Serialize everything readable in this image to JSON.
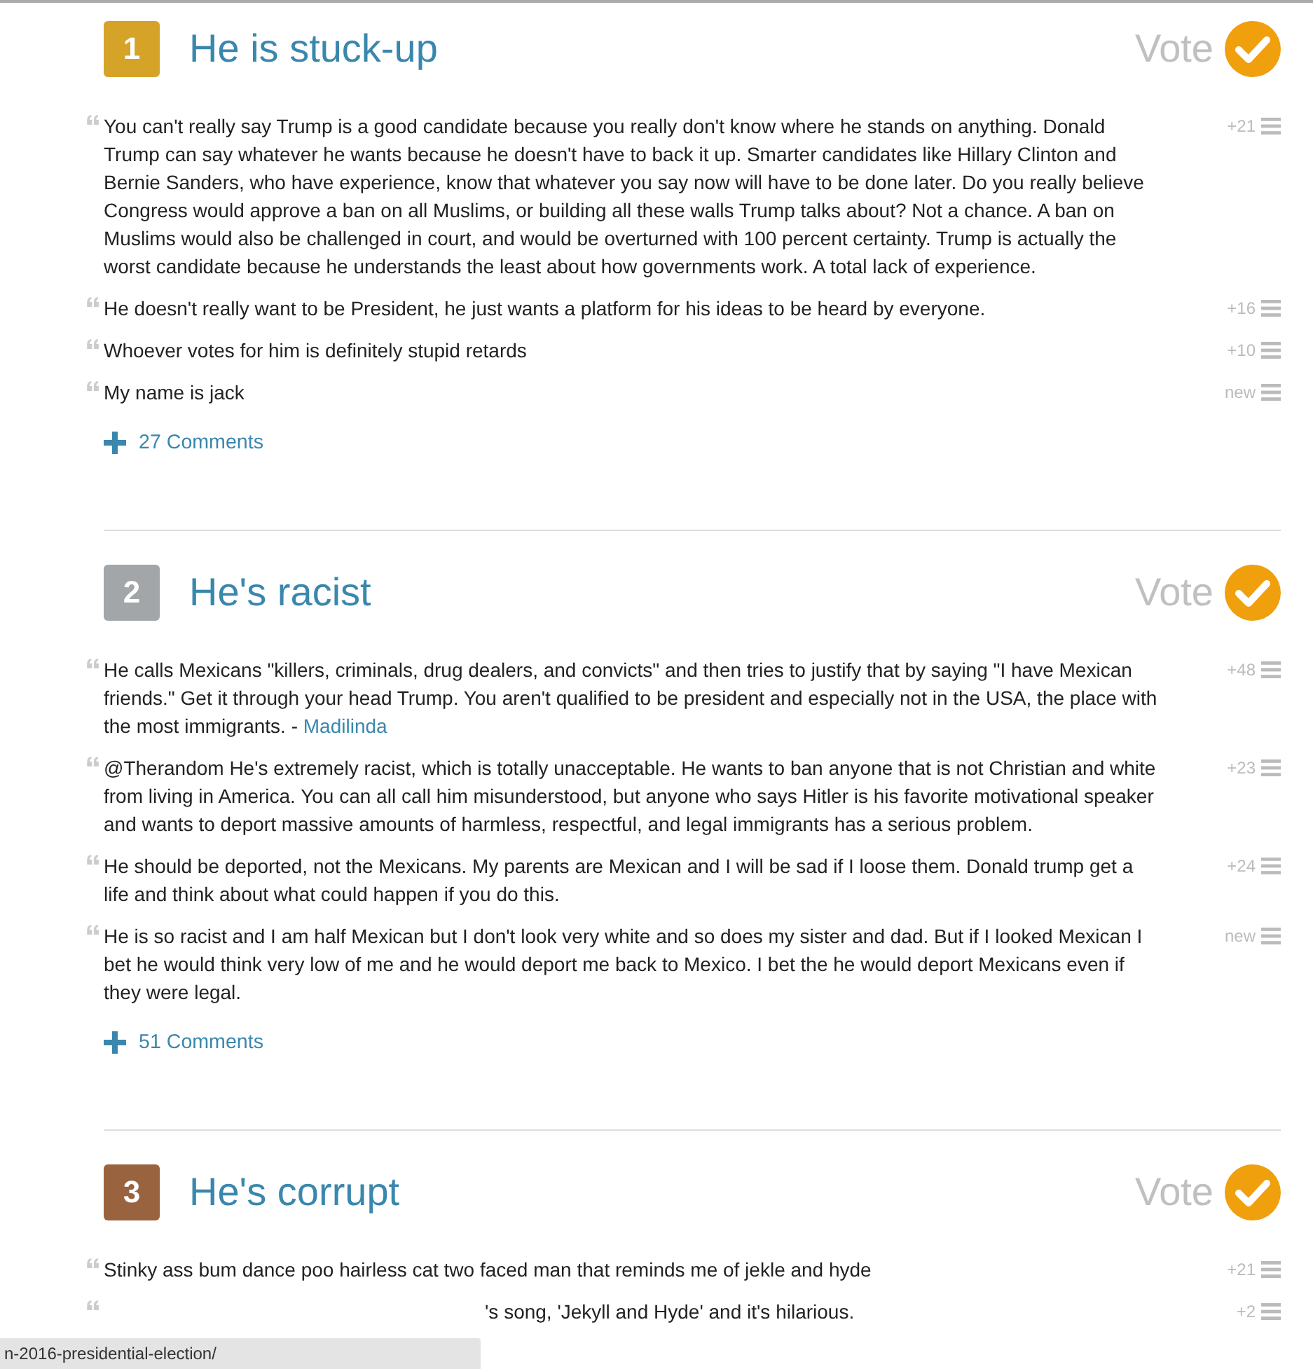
{
  "sections": [
    {
      "rank": "1",
      "color": "#d6a329",
      "title": "He is stuck-up",
      "vote": "Vote",
      "comments": [
        {
          "kind": "full",
          "text": "You can't really say Trump is a good candidate because you really don't know where he stands on anything. Donald Trump can say whatever he wants because he doesn't have to back it up. Smarter candidates like Hillary Clinton and Bernie Sanders, who have experience, know that whatever you say now will have to be done later. Do you really believe Congress would approve a ban on all Muslims, or building all these walls Trump talks about? Not a chance. A ban on Muslims would also be challenged in court, and would be overturned with 100 percent certainty. Trump is actually the worst candidate because he understands the least about how governments work. A total lack of experience.",
          "score": "+21"
        },
        {
          "kind": "full",
          "text": "He doesn't really want to be President, he just wants a platform for his ideas to be heard by everyone.",
          "score": "+16"
        },
        {
          "kind": "full",
          "text": "Whoever votes for him is definitely stupid retards",
          "score": "+10"
        },
        {
          "kind": "full",
          "text": "My name is jack",
          "score": "new"
        }
      ],
      "more": "27 Comments"
    },
    {
      "rank": "2",
      "color": "#a2a6a8",
      "title": "He's racist",
      "vote": "Vote",
      "comments": [
        {
          "kind": "full",
          "text": "He calls Mexicans \"killers, criminals, drug dealers, and convicts\" and then tries to justify that by saying \"I have Mexican friends.\" Get it through your head Trump. You aren't qualified to be president and especially not in the USA, the place with the most immigrants. -",
          "author": "Madilinda",
          "score": "+48"
        },
        {
          "kind": "full",
          "text": "@Therandom He's extremely racist, which is totally unacceptable. He wants to ban anyone that is not Christian and white from living in America. You can all call him misunderstood, but anyone who says Hitler is his favorite motivational speaker and wants to deport massive amounts of harmless, respectful, and legal immigrants has a serious problem.",
          "score": "+23"
        },
        {
          "kind": "full",
          "text": "He should be deported, not the Mexicans. My parents are Mexican and I will be sad if I loose them. Donald trump get a life and think about what could happen if you do this.",
          "score": "+24"
        },
        {
          "kind": "full",
          "text": "He is so racist and I am half Mexican but I don't look very white and so does my sister and dad. But if I looked Mexican I bet he would think very low of me and he would deport me back to Mexico. I bet the he would deport Mexicans even if they were legal.",
          "score": "new"
        }
      ],
      "more": "51 Comments"
    },
    {
      "rank": "3",
      "color": "#9a6340",
      "title": "He's corrupt",
      "vote": "Vote",
      "comments": [
        {
          "kind": "full",
          "text": "Stinky ass bum dance poo hairless cat two faced man that reminds me of jekle and hyde",
          "score": "+21"
        },
        {
          "kind": "covered",
          "text": "'s song, 'Jekyll and Hyde' and it's hilarious.",
          "score": "+2"
        }
      ]
    }
  ],
  "status_bar": "n-2016-presidential-election/"
}
